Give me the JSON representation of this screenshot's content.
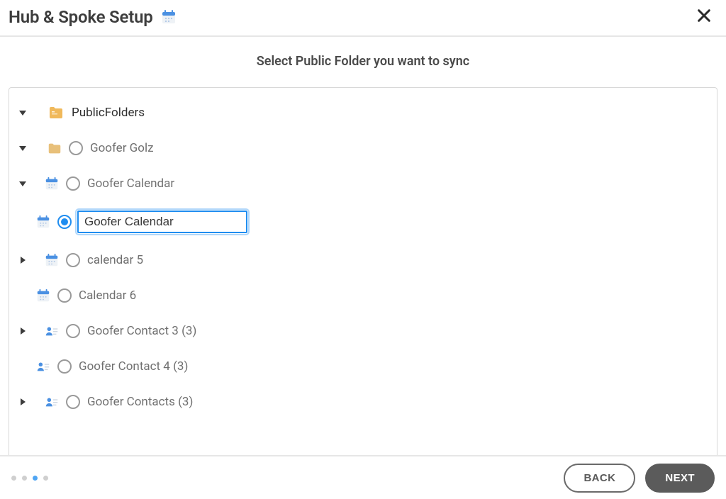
{
  "header": {
    "title": "Hub & Spoke Setup"
  },
  "instruction": "Select Public Folder you want to sync",
  "tree": {
    "root": {
      "label": "PublicFolders",
      "expanded": true
    },
    "level1": {
      "goofer_golz": {
        "label": "Goofer Golz",
        "expanded": true,
        "selected": false
      }
    },
    "level2": {
      "goofer_calendar": {
        "label": "Goofer Calendar",
        "expanded": true,
        "selected": false
      },
      "goofer_contact3": {
        "label": "Goofer Contact 3 (3)",
        "expanded": false,
        "selected": false,
        "has_children": true
      },
      "goofer_contact4": {
        "label": "Goofer Contact 4 (3)",
        "expanded": false,
        "selected": false,
        "has_children": false
      },
      "goofer_contacts": {
        "label": "Goofer Contacts (3)",
        "expanded": false,
        "selected": false,
        "has_children": true
      }
    },
    "level3": {
      "goofer_calendar_input": {
        "value": "Goofer Calendar",
        "selected": true
      },
      "calendar5": {
        "label": "calendar 5",
        "expanded": false,
        "selected": false,
        "has_children": true
      },
      "calendar6": {
        "label": "Calendar 6",
        "expanded": false,
        "selected": false,
        "has_children": false
      }
    }
  },
  "footer": {
    "back": "BACK",
    "next": "NEXT",
    "steps_total": 4,
    "active_step_index": 2
  },
  "icons": {
    "folder": "folder-icon",
    "folder_root": "folder-root-icon",
    "calendar": "calendar-icon",
    "contact": "contact-icon"
  }
}
